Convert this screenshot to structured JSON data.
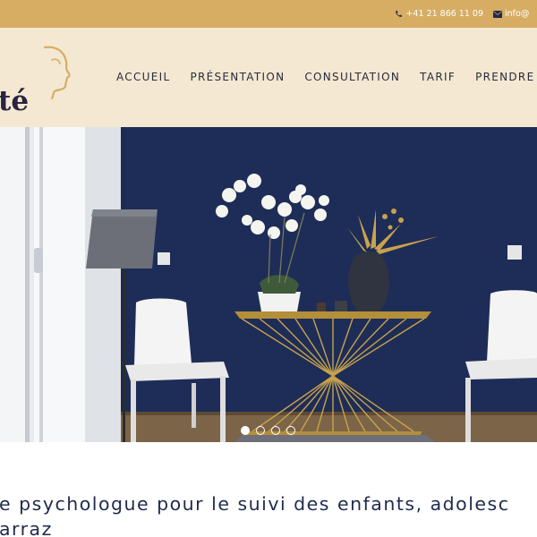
{
  "topbar": {
    "phone": "+41 21 866 11 09",
    "email": "info@",
    "phone_icon": "phone-icon",
    "email_icon": "envelope-icon",
    "color": "#d7ad64"
  },
  "header": {
    "logo_text": "té",
    "logo_icon": "face-profile-icon",
    "background": "#f4e8d2"
  },
  "nav": {
    "items": [
      "ACCUEIL",
      "PRÉSENTATION",
      "CONSULTATION",
      "TARIF",
      "PRENDRE R"
    ]
  },
  "slider": {
    "slide_count": 4,
    "active_index": 0
  },
  "intro": {
    "line1": "e psychologue pour le suivi des enfants, adolesc",
    "line2": "arraz"
  },
  "colors": {
    "accent_gold": "#d7ad64",
    "navy_text": "#1f2b4d",
    "wall_navy": "#1c2a52"
  }
}
